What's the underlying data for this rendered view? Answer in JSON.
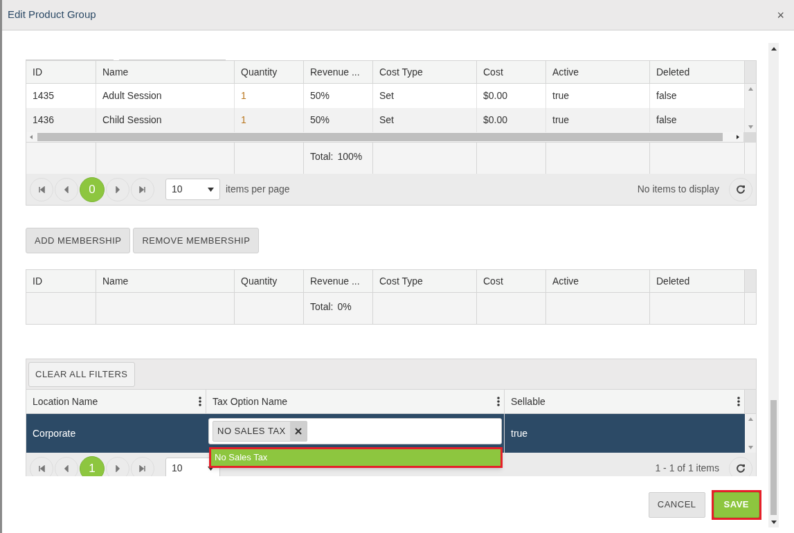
{
  "dialog": {
    "title": "Edit Product Group",
    "close": "×"
  },
  "products_grid": {
    "columns": [
      "ID",
      "Name",
      "Quantity",
      "Revenue ...",
      "Cost Type",
      "Cost",
      "Active",
      "Deleted"
    ],
    "rows": [
      {
        "cells": [
          "1435",
          "Adult Session",
          "1",
          "50%",
          "Set",
          "$0.00",
          "true",
          "false"
        ]
      },
      {
        "cells": [
          "1436",
          "Child Session",
          "1",
          "50%",
          "Set",
          "$0.00",
          "true",
          "false"
        ]
      }
    ],
    "total": {
      "label": "Total:",
      "value": "100%"
    },
    "pager": {
      "page": "0",
      "page_size": "10",
      "page_size_label": "items per page",
      "info": "No items to display"
    }
  },
  "membership_buttons": [
    "ADD MEMBERSHIP",
    "REMOVE MEMBERSHIP"
  ],
  "membership_grid": {
    "columns": [
      "ID",
      "Name",
      "Quantity",
      "Revenue ...",
      "Cost Type",
      "Cost",
      "Active",
      "Deleted"
    ],
    "total": {
      "label": "Total:",
      "value": "0%"
    }
  },
  "locations_grid": {
    "toolbar_button": "CLEAR ALL FILTERS",
    "columns": [
      "Location Name",
      "Tax Option Name",
      "Sellable"
    ],
    "rows": [
      {
        "location": "Corporate",
        "tax_option_tag": "NO SALES TAX",
        "sellable": "true",
        "selected": true
      }
    ],
    "dropdown_options": [
      {
        "label": "No Sales Tax",
        "highlighted": true
      }
    ],
    "pager": {
      "page": "1",
      "page_size": "10",
      "info": "1 - 1 of 1 items"
    }
  },
  "buttons": [
    {
      "label": "CANCEL",
      "kind": "secondary",
      "highlighted": false
    },
    {
      "label": "SAVE",
      "kind": "primary",
      "highlighted": true
    }
  ]
}
